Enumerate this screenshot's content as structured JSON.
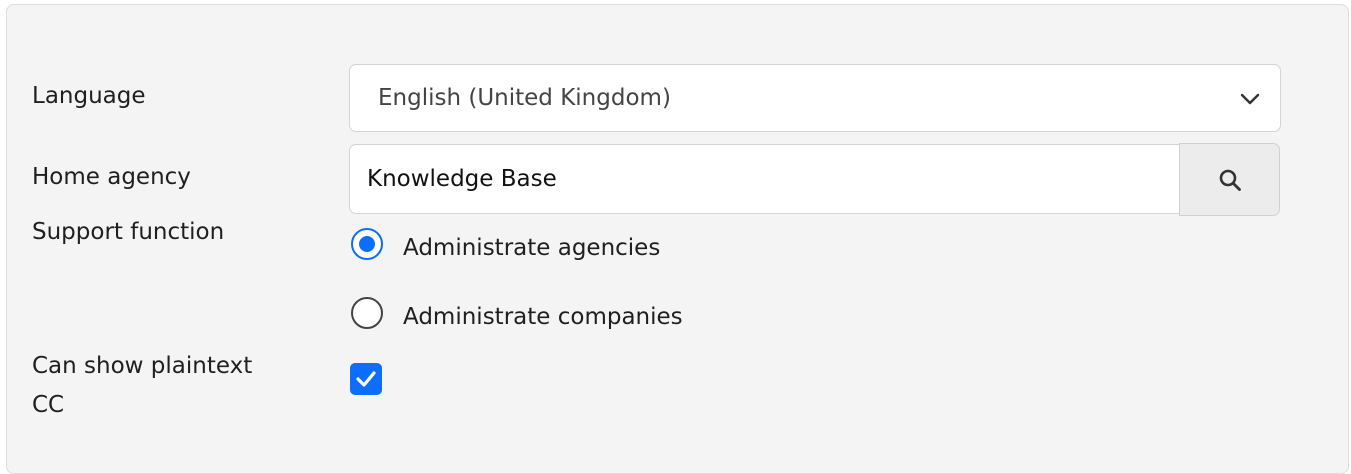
{
  "form": {
    "language": {
      "label": "Language",
      "selected": "English (United Kingdom)",
      "icon": "chevron-down-icon"
    },
    "home_agency": {
      "label": "Home agency",
      "value": "Knowledge Base",
      "button_icon": "search-icon"
    },
    "support_function": {
      "label": "Support function",
      "options": [
        {
          "label": "Administrate agencies",
          "checked": true
        },
        {
          "label": "Administrate companies",
          "checked": false
        }
      ]
    },
    "plaintext_cc": {
      "label_line1": "Can show plaintext",
      "label_line2": "CC",
      "checked": true
    }
  },
  "colors": {
    "accent": "#0d6efd",
    "panel_bg": "#f4f4f4"
  }
}
